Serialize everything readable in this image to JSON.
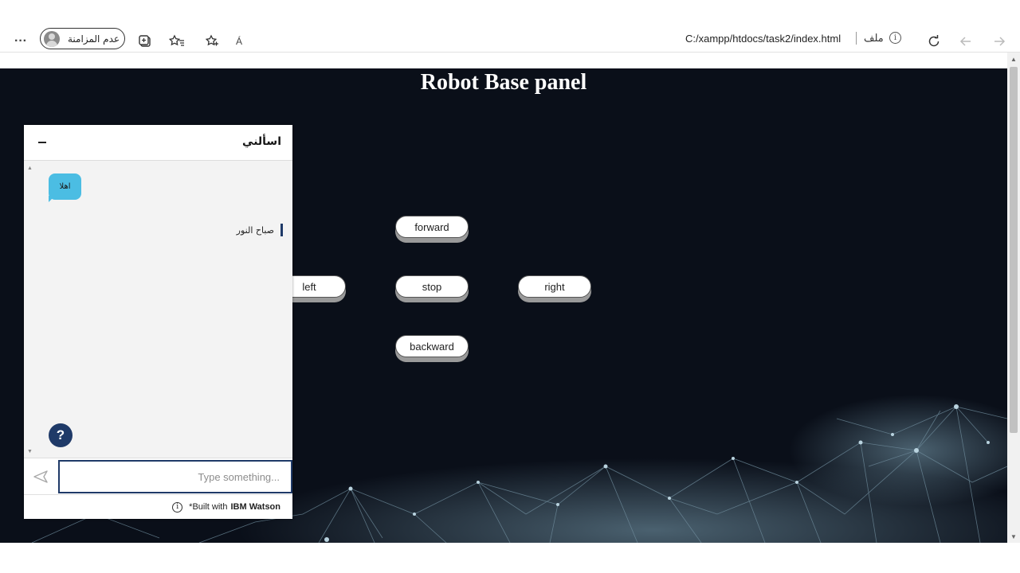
{
  "browser": {
    "more_icon": "ellipsis-icon",
    "profile_label": "عدم المزامنة",
    "read_aloud_label": "Á",
    "address": "C:/xampp/htdocs/task2/index.html",
    "file_label": "ملف",
    "info_glyph": "i"
  },
  "page": {
    "title": "Robot Base panel",
    "controls": {
      "forward": "forward",
      "left": "left",
      "stop": "stop",
      "right": "right",
      "backward": "backward"
    }
  },
  "chat": {
    "title": "اسألني",
    "user_message": "اهلا",
    "bot_reply": "صباح النور",
    "help_label": "?",
    "input_placeholder": "Type something...",
    "footer_prefix": "*Built with",
    "footer_brand": "IBM Watson",
    "footer_info": "i",
    "accent": "#1f3a68",
    "bubble_color": "#4bbde3"
  }
}
